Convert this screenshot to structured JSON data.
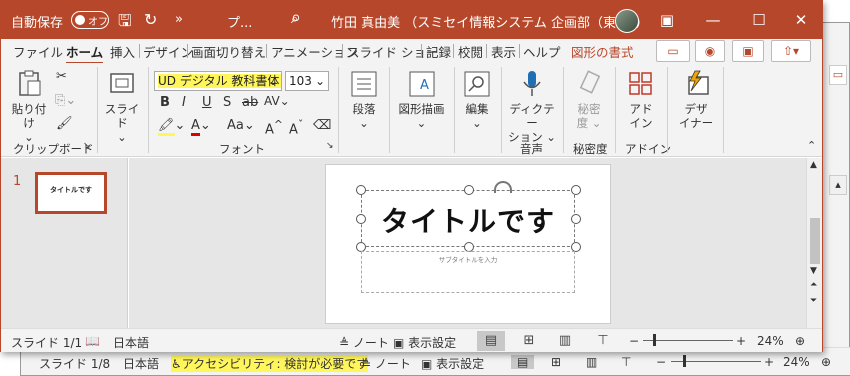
{
  "background_window": {
    "status_slide": "スライド 1/8",
    "status_lang": "日本語",
    "status_accessibility": "アクセシビリティ: 検討が必要です",
    "status_notes": "ノート",
    "status_view_settings": "表示設定",
    "zoom": "24%"
  },
  "titlebar": {
    "autosave_label": "自動保存",
    "autosave_state": "オフ",
    "more": "»",
    "doc_name": "プ...",
    "user_name": "竹田 真由美 （スミセイ情報システム 企画部（東京））"
  },
  "tabs": [
    "ファイル",
    "ホーム",
    "挿入",
    "デザイン",
    "画面切り替え",
    "アニメーション",
    "スライド ショー",
    "記録",
    "校閲",
    "表示",
    "ヘルプ",
    "図形の書式"
  ],
  "ribbon": {
    "paste": "貼り付け",
    "clipboard_group": "クリップボード",
    "slide": "スライド",
    "font_name": "UD デジタル 教科書体 N",
    "font_size": "103",
    "font_group": "フォント",
    "bold": "B",
    "italic": "I",
    "underline": "U",
    "shadow": "S",
    "strike": "ab",
    "change_case": "Aa",
    "grow": "A",
    "shrink": "A",
    "paragraph": "段落",
    "drawing": "図形描画",
    "editing": "編集",
    "dictate_1": "ディクテー",
    "dictate_2": "ション",
    "voice_group": "音声",
    "sensitivity_1": "秘密",
    "sensitivity_2": "度",
    "sensitivity_group": "秘密度",
    "addins_1": "アド",
    "addins_2": "イン",
    "addins_group": "アドイン",
    "designer_1": "デザ",
    "designer_2": "イナー"
  },
  "slides_pane": {
    "number": "1",
    "thumb_title": "タイトルです"
  },
  "slide": {
    "title": "タイトルです",
    "subtitle_placeholder": "サブタイトルを入力"
  },
  "status": {
    "slide": "スライド 1/1",
    "lang": "日本語",
    "notes": "ノート",
    "view_settings": "表示設定",
    "zoom": "24%"
  },
  "colors": {
    "accent": "#b7472a",
    "highlight": "#fff65c"
  }
}
